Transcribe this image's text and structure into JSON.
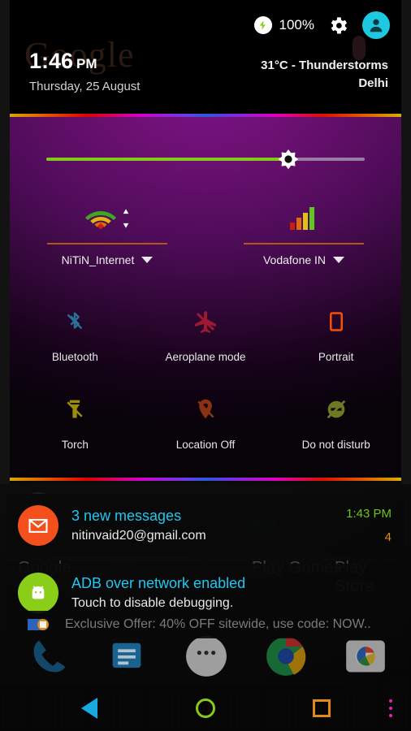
{
  "status_bar": {
    "battery_percent": "100%",
    "battery_icon": "charging-bolt-icon",
    "settings_icon": "gear-icon",
    "avatar_icon": "user-avatar-icon"
  },
  "header": {
    "time": "1:46",
    "ampm": "PM",
    "date": "Thursday, 25 August",
    "weather": "31°C - Thunderstorms",
    "city": "Delhi",
    "ghost_widget": "Google"
  },
  "brightness": {
    "label": "brightness-slider",
    "value_percent": 76,
    "fill_color": "#84c91a",
    "track_color": "#9a7ba2",
    "thumb_icon": "brightness-sun-icon"
  },
  "connections": [
    {
      "id": "wifi",
      "icon": "wifi-signal-icon",
      "label": "NiTiN_Internet",
      "caret": "chevron-down-icon"
    },
    {
      "id": "cell",
      "icon": "cellular-bars-icon",
      "label": "Vodafone IN",
      "caret": "chevron-down-icon"
    }
  ],
  "tiles": [
    {
      "id": "bluetooth",
      "label": "Bluetooth",
      "icon": "bluetooth-off-icon",
      "color": "#2a6f96",
      "enabled": false
    },
    {
      "id": "aeroplane",
      "label": "Aeroplane mode",
      "icon": "airplane-off-icon",
      "color": "#a01830",
      "enabled": false
    },
    {
      "id": "portrait",
      "label": "Portrait",
      "icon": "screen-rotation-icon",
      "color": "#f4500a",
      "enabled": true
    },
    {
      "id": "torch",
      "label": "Torch",
      "icon": "flashlight-off-icon",
      "color": "#9a8c10",
      "enabled": false
    },
    {
      "id": "location",
      "label": "Location Off",
      "icon": "location-off-icon",
      "color": "#8a3212",
      "enabled": false
    },
    {
      "id": "dnd",
      "label": "Do not disturb",
      "icon": "do-not-disturb-icon",
      "color": "#6e7a22",
      "enabled": false
    }
  ],
  "notifications": [
    {
      "id": "gmail",
      "icon": "gmail-icon",
      "icon_bg": "#f4501e",
      "title": "3 new messages",
      "subtitle": "nitinvaid20@gmail.com",
      "time": "1:43 PM",
      "count": "4"
    },
    {
      "id": "adb",
      "icon": "android-head-icon",
      "icon_bg": "#8ace1a",
      "title": "ADB over network enabled",
      "subtitle": "Touch to disable debugging."
    },
    {
      "id": "promo",
      "icon": "promo-app-icon",
      "text": "Exclusive Offer: 40% OFF sitewide, use code: NOW.."
    }
  ],
  "homescreen": {
    "widget_label": "Google",
    "app_labels": [
      "Play Games",
      "Play Store"
    ],
    "dock": [
      "phone-icon",
      "messages-icon",
      "app-drawer-icon",
      "chrome-icon",
      "camera-icon"
    ]
  },
  "navbar": {
    "back": "back-triangle-icon",
    "home": "home-circle-icon",
    "recents": "recents-square-icon",
    "menu": "overflow-menu-icon",
    "colors": {
      "back": "#1aa8e0",
      "home": "#8ac81a",
      "recents": "#e08a18",
      "menu": "#e020c0"
    }
  }
}
